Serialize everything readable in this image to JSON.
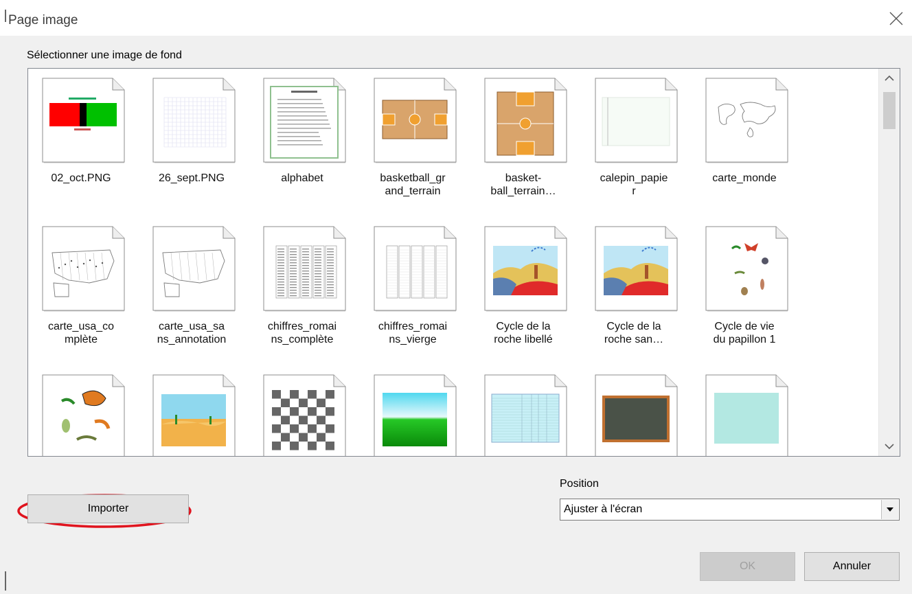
{
  "window": {
    "title": "Page image"
  },
  "gallery": {
    "label": "Sélectionner une image de fond",
    "items": [
      {
        "caption": "02_oct.PNG",
        "thumb": "flag"
      },
      {
        "caption": "26_sept.PNG",
        "thumb": "grid"
      },
      {
        "caption": "alphabet",
        "thumb": "alphabet"
      },
      {
        "caption": "basketball_gr\nand_terrain",
        "thumb": "court-h"
      },
      {
        "caption": "basket-\nball_terrain…",
        "thumb": "court-v"
      },
      {
        "caption": "calepin_papie\nr",
        "thumb": "notepad"
      },
      {
        "caption": "carte_monde",
        "thumb": "world"
      },
      {
        "caption": "carte_usa_co\nmplète",
        "thumb": "usa"
      },
      {
        "caption": "carte_usa_sa\nns_annotation",
        "thumb": "usa2"
      },
      {
        "caption": "chiffres_romai\nns_complète",
        "thumb": "roman"
      },
      {
        "caption": "chiffres_romai\nns_vierge",
        "thumb": "roman2"
      },
      {
        "caption": "Cycle de la\nroche libellé",
        "thumb": "rock"
      },
      {
        "caption": "Cycle de la\nroche san…",
        "thumb": "rock2"
      },
      {
        "caption": "Cycle de vie\ndu papillon 1",
        "thumb": "butterfly"
      },
      {
        "caption": "",
        "thumb": "butterfly2"
      },
      {
        "caption": "",
        "thumb": "desert"
      },
      {
        "caption": "",
        "thumb": "checker"
      },
      {
        "caption": "",
        "thumb": "gradient"
      },
      {
        "caption": "",
        "thumb": "table"
      },
      {
        "caption": "",
        "thumb": "chalkboard"
      },
      {
        "caption": "",
        "thumb": "teal"
      }
    ]
  },
  "import_button": {
    "label": "Importer"
  },
  "position": {
    "label": "Position",
    "value": "Ajuster à l'écran"
  },
  "ok_button": {
    "label": "OK"
  },
  "cancel_button": {
    "label": "Annuler"
  },
  "colors": {
    "highlight_ellipse": "#e0141e",
    "disabled_text": "#a0a0a0"
  }
}
